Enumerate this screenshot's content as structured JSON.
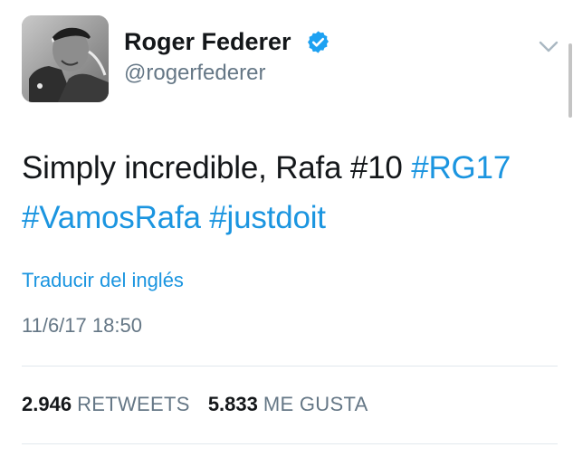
{
  "author": {
    "display_name": "Roger Federer",
    "handle": "@rogerfederer",
    "verified": true,
    "avatar_icon": "avatar-photo"
  },
  "tweet": {
    "text_plain": "Simply incredible, Rafa #10",
    "hashtags": [
      "#RG17",
      "#VamosRafa",
      "#justdoit"
    ],
    "translate_label": "Traducir del inglés",
    "timestamp": "11/6/17 18:50"
  },
  "stats": {
    "retweets_count": "2.946",
    "retweets_label": "RETWEETS",
    "likes_count": "5.833",
    "likes_label": "ME GUSTA"
  },
  "colors": {
    "link": "#1b95e0",
    "text": "#14171a",
    "secondary": "#657786",
    "divider": "#e1e8ed",
    "verified": "#1da1f2"
  }
}
